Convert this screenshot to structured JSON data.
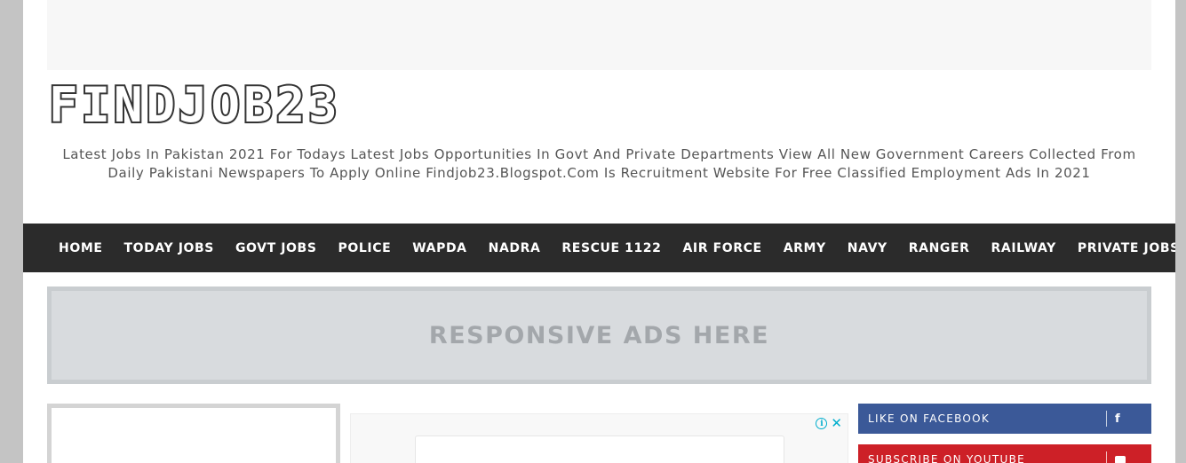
{
  "site": {
    "title": "FINDJOB23",
    "tagline": "Latest Jobs In Pakistan 2021 For Todays Latest Jobs Opportunities In Govt And Private Departments View All New Government Careers Collected From Daily Pakistani Newspapers To Apply Online Findjob23.Blogspot.Com Is Recruitment Website For Free Classified Employment Ads In 2021"
  },
  "nav": {
    "items": [
      {
        "label": "HOME"
      },
      {
        "label": "TODAY JOBS"
      },
      {
        "label": "GOVT JOBS"
      },
      {
        "label": "POLICE"
      },
      {
        "label": "WAPDA"
      },
      {
        "label": "NADRA"
      },
      {
        "label": "RESCUE 1122"
      },
      {
        "label": "AIR FORCE"
      },
      {
        "label": "ARMY"
      },
      {
        "label": "NAVY"
      },
      {
        "label": "RANGER"
      },
      {
        "label": "RAILWAY"
      },
      {
        "label": "PRIVATE JOBS"
      }
    ]
  },
  "ad_banner": {
    "text": "RESPONSIVE ADS HERE"
  },
  "ad_frame": {
    "info_icon": "info-icon",
    "close_icon": "close-icon"
  },
  "social": {
    "facebook": {
      "label": "LIKE ON FACEBOOK",
      "icon": "facebook-icon",
      "glyph": "f",
      "color": "#3b5998"
    },
    "youtube": {
      "label": "SUBSCRIBE ON YOUTUBE",
      "icon": "youtube-icon",
      "color": "#cd2027"
    }
  },
  "colors": {
    "nav_bg": "#2b2b2b",
    "page_bg": "#c4c4c4",
    "ad_banner_bg": "#d8dbde",
    "ad_accent": "#00aecd"
  }
}
